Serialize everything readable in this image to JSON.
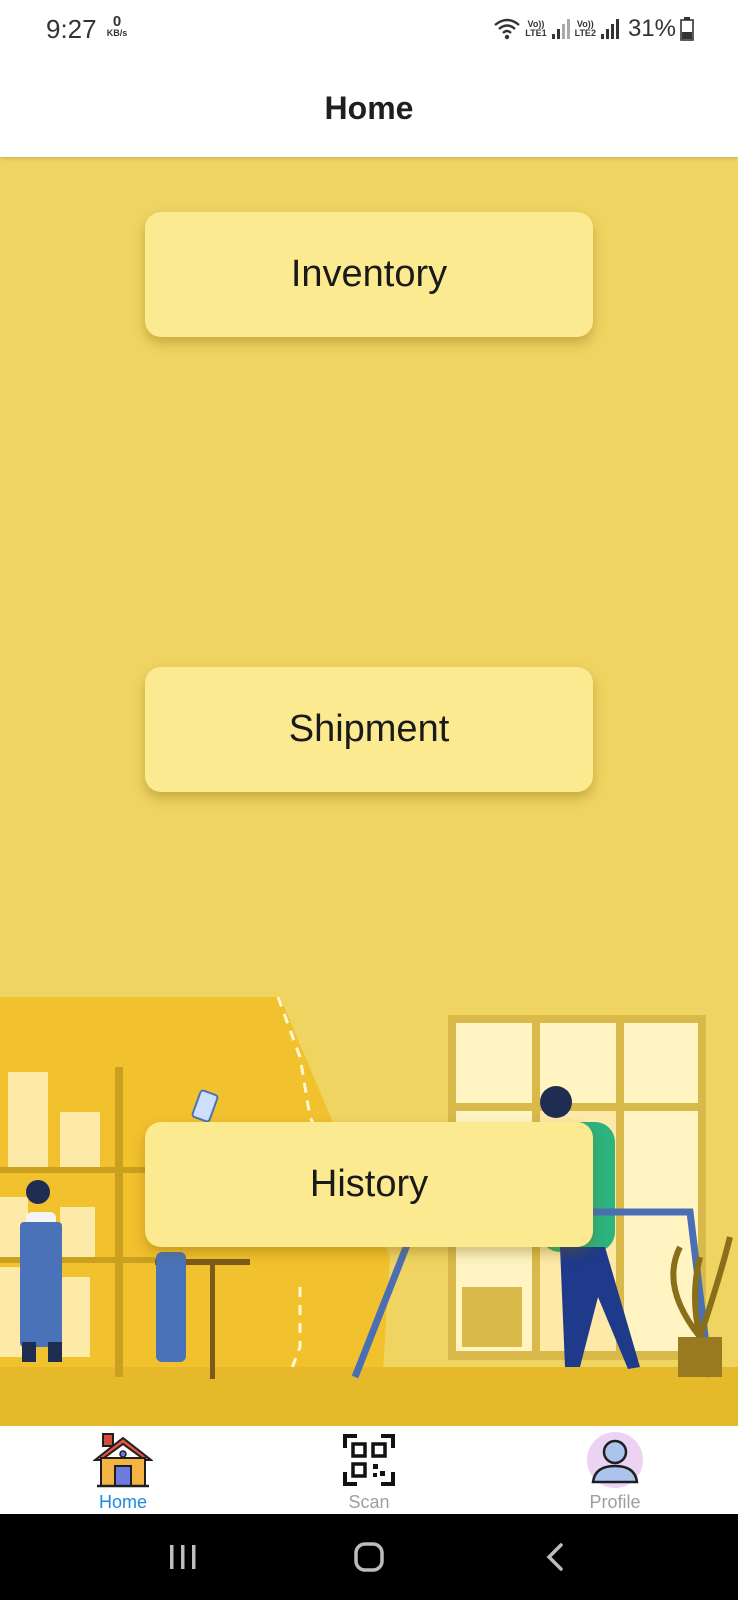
{
  "status_bar": {
    "time": "9:27",
    "speed_value": "0",
    "speed_unit": "KB/s",
    "sim1": "Vo))\nLTE1",
    "sim2": "Vo))\nLTE2",
    "battery": "31%"
  },
  "header": {
    "title": "Home"
  },
  "menu": {
    "inventory_label": "Inventory",
    "shipment_label": "Shipment",
    "history_label": "History"
  },
  "bottom_nav": {
    "items": [
      {
        "label": "Home",
        "icon": "home-icon",
        "active": true
      },
      {
        "label": "Scan",
        "icon": "qr-scan-icon",
        "active": false
      },
      {
        "label": "Profile",
        "icon": "profile-icon",
        "active": false
      }
    ]
  },
  "colors": {
    "background": "#f0d462",
    "button": "#fcea90",
    "active_tab": "#1e88e5",
    "inactive_tab": "#9e9e9e"
  }
}
